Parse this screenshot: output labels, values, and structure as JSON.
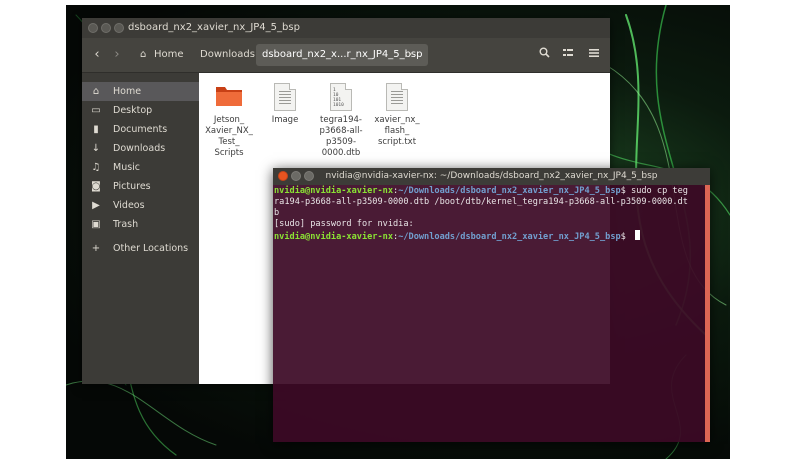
{
  "file_manager": {
    "title": "dsboard_nx2_xavier_nx_JP4_5_bsp",
    "breadcrumbs": [
      "Home",
      "Downloads",
      "dsboard_nx2_x...r_nx_JP4_5_bsp"
    ],
    "sidebar": [
      {
        "label": "Home",
        "icon": "home-icon"
      },
      {
        "label": "Desktop",
        "icon": "desktop-icon"
      },
      {
        "label": "Documents",
        "icon": "documents-icon"
      },
      {
        "label": "Downloads",
        "icon": "downloads-icon"
      },
      {
        "label": "Music",
        "icon": "music-icon"
      },
      {
        "label": "Pictures",
        "icon": "pictures-icon"
      },
      {
        "label": "Videos",
        "icon": "videos-icon"
      },
      {
        "label": "Trash",
        "icon": "trash-icon"
      },
      {
        "label": "Other Locations",
        "icon": "add-icon"
      }
    ],
    "files": [
      {
        "name": "Jetson_Xavier_NX_Test_Scripts",
        "lines": [
          "Jetson_",
          "Xavier_NX_",
          "Test_",
          "Scripts"
        ],
        "icon": "folder-icon"
      },
      {
        "name": "Image",
        "lines": [
          "Image"
        ],
        "icon": "text-file-icon"
      },
      {
        "name": "tegra194-p3668-all-p3509-0000.dtb",
        "lines": [
          "tegra194-",
          "p3668-all-",
          "p3509-",
          "0000.dtb"
        ],
        "icon": "binary-file-icon"
      },
      {
        "name": "xavier_nx_flash_script.txt",
        "lines": [
          "xavier_nx_",
          "flash_",
          "script.txt"
        ],
        "icon": "text-file-icon"
      }
    ]
  },
  "terminal": {
    "title": "nvidia@nvidia-xavier-nx: ~/Downloads/dsboard_nx2_xavier_nx_JP4_5_bsp",
    "prompt_user": "nvidia@nvidia-xavier-nx",
    "prompt_path": "~/Downloads/dsboard_nx2_xavier_nx_JP4_5_bsp",
    "command_line_1": "$ sudo cp teg",
    "command_line_2": "ra194-p3668-all-p3509-0000.dtb /boot/dtb/kernel_tegra194-p3668-all-p3509-0000.dt",
    "command_line_3": "b",
    "output_line": "[sudo] password for nvidia:",
    "prompt_suffix": "$ "
  },
  "colors": {
    "terminal_bg": "#3c0a26",
    "prompt_user": "#8ae234",
    "prompt_path": "#729fcf",
    "folder": "#e95420"
  }
}
